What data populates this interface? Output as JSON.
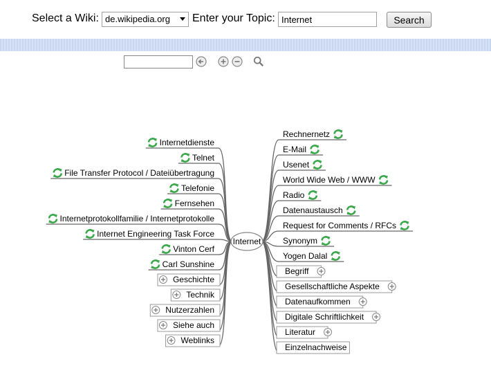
{
  "header": {
    "wiki_label": "Select a Wiki:",
    "wiki_value": "de.wikipedia.org",
    "topic_label": "Enter your Topic:",
    "topic_value": "Internet",
    "search_label": "Search"
  },
  "toolbar": {
    "icons": [
      "back-arrow-icon",
      "zoom-in-icon",
      "zoom-out-icon",
      "magnifier-icon"
    ]
  },
  "mindmap": {
    "center": "Internet",
    "left": [
      {
        "label": "Internetdienste",
        "icon": "refresh"
      },
      {
        "label": "Telnet",
        "icon": "refresh"
      },
      {
        "label": "File Transfer Protocol / Dateiübertragung",
        "icon": "refresh"
      },
      {
        "label": "Telefonie",
        "icon": "refresh"
      },
      {
        "label": "Fernsehen",
        "icon": "refresh"
      },
      {
        "label": "Internetprotokollfamilie / Internetprotokolle",
        "icon": "refresh"
      },
      {
        "label": "Internet Engineering Task Force",
        "icon": "refresh"
      },
      {
        "label": "Vinton Cerf",
        "icon": "refresh"
      },
      {
        "label": "Carl Sunshine",
        "icon": "refresh"
      },
      {
        "label": "Geschichte",
        "icon": "expand"
      },
      {
        "label": "Technik",
        "icon": "expand"
      },
      {
        "label": "Nutzerzahlen",
        "icon": "expand"
      },
      {
        "label": "Siehe auch",
        "icon": "expand"
      },
      {
        "label": "Weblinks",
        "icon": "expand"
      }
    ],
    "right": [
      {
        "label": "Rechnernetz",
        "icon": "refresh"
      },
      {
        "label": "E-Mail",
        "icon": "refresh"
      },
      {
        "label": "Usenet",
        "icon": "refresh"
      },
      {
        "label": "World Wide Web / WWW",
        "icon": "refresh"
      },
      {
        "label": "Radio",
        "icon": "refresh"
      },
      {
        "label": "Datenaustausch",
        "icon": "refresh"
      },
      {
        "label": "Request for Comments / RFCs",
        "icon": "refresh"
      },
      {
        "label": "Synonym",
        "icon": "refresh"
      },
      {
        "label": "Yogen Dalal",
        "icon": "refresh"
      },
      {
        "label": "Begriff",
        "icon": "expand"
      },
      {
        "label": "Gesellschaftliche Aspekte",
        "icon": "expand"
      },
      {
        "label": "Datenaufkommen",
        "icon": "expand"
      },
      {
        "label": "Digitale Schriftlichkeit",
        "icon": "expand"
      },
      {
        "label": "Literatur",
        "icon": "expand"
      },
      {
        "label": "Einzelnachweise",
        "icon": "none"
      }
    ]
  }
}
